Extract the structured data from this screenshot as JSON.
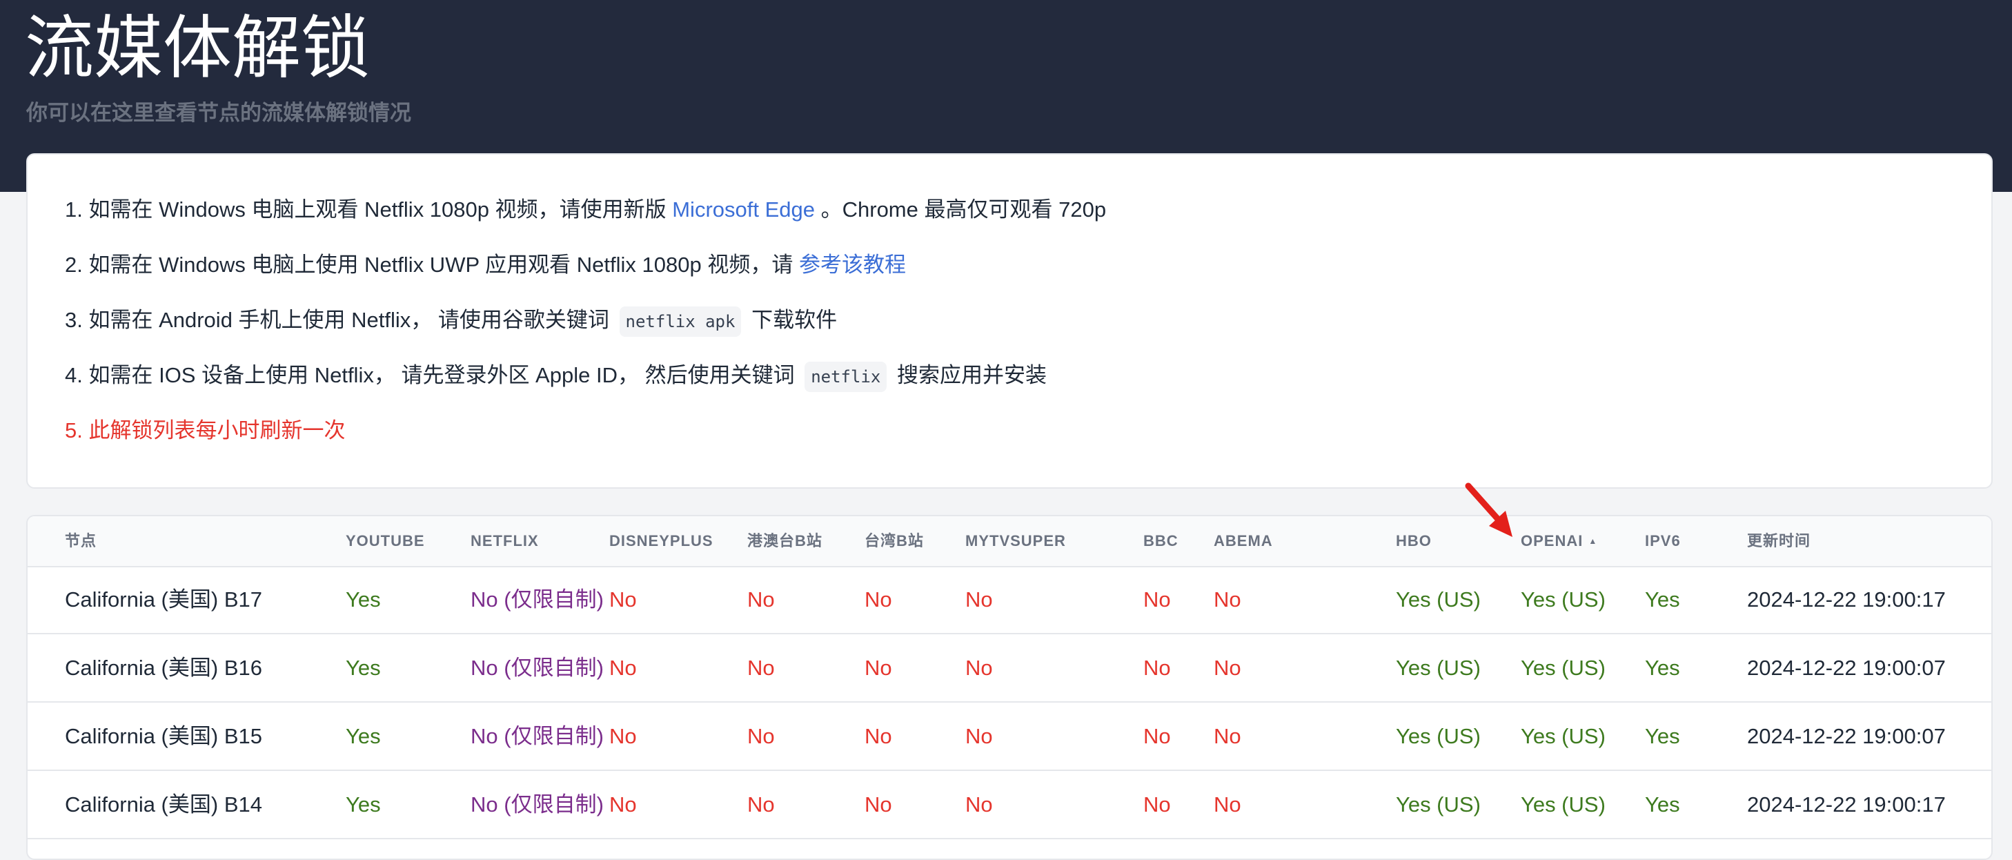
{
  "header": {
    "title": "流媒体解锁",
    "subtitle": "你可以在这里查看节点的流媒体解锁情况"
  },
  "notices": {
    "n1": {
      "pre": "1. 如需在 Windows 电脑上观看 Netflix 1080p 视频，请使用新版 ",
      "link": "Microsoft Edge",
      "post": " 。Chrome 最高仅可观看 720p"
    },
    "n2": {
      "pre": "2. 如需在 Windows 电脑上使用 Netflix UWP 应用观看 Netflix 1080p 视频，请 ",
      "link": "参考该教程"
    },
    "n3": {
      "pre": "3. 如需在 Android 手机上使用 Netflix， 请使用谷歌关键词 ",
      "code": "netflix apk",
      "post": " 下载软件"
    },
    "n4": {
      "pre": "4. 如需在 IOS 设备上使用 Netflix， 请先登录外区 Apple ID， 然后使用关键词 ",
      "code": "netflix",
      "post": " 搜索应用并安装"
    },
    "n5": {
      "text": "5. 此解锁列表每小时刷新一次"
    }
  },
  "table": {
    "columns": [
      "节点",
      "YOUTUBE",
      "NETFLIX",
      "DISNEYPLUS",
      "港澳台B站",
      "台湾B站",
      "MYTVSUPER",
      "BBC",
      "ABEMA",
      "HBO",
      "OPENAI",
      "IPV6",
      "更新时间"
    ],
    "sort_indicator": "▲",
    "rows": [
      [
        "California (美国) B17",
        "Yes",
        "No (仅限自制)",
        "No",
        "No",
        "No",
        "No",
        "No",
        "No",
        "Yes (US)",
        "Yes (US)",
        "Yes",
        "2024-12-22 19:00:17"
      ],
      [
        "California (美国) B16",
        "Yes",
        "No (仅限自制)",
        "No",
        "No",
        "No",
        "No",
        "No",
        "No",
        "Yes (US)",
        "Yes (US)",
        "Yes",
        "2024-12-22 19:00:07"
      ],
      [
        "California (美国) B15",
        "Yes",
        "No (仅限自制)",
        "No",
        "No",
        "No",
        "No",
        "No",
        "No",
        "Yes (US)",
        "Yes (US)",
        "Yes",
        "2024-12-22 19:00:07"
      ],
      [
        "California (美国) B14",
        "Yes",
        "No (仅限自制)",
        "No",
        "No",
        "No",
        "No",
        "No",
        "No",
        "Yes (US)",
        "Yes (US)",
        "Yes",
        "2024-12-22 19:00:17"
      ]
    ]
  },
  "colors": {
    "hero_bg": "#232a3d",
    "yes": "#3d7a1e",
    "no": "#e5352d",
    "self_only": "#7b2d8c",
    "link": "#3b6ed6",
    "annotation_arrow": "#e3201b"
  },
  "icons": {
    "annotation": "red-arrow-icon"
  }
}
